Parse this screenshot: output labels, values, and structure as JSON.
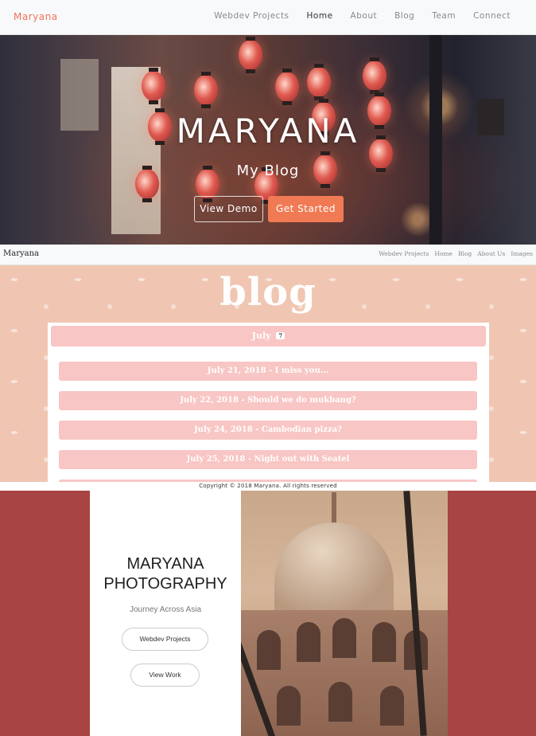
{
  "hero_nav": {
    "brand": "Maryana",
    "links": [
      "Webdev Projects",
      "Home",
      "About",
      "Blog",
      "Team",
      "Connect"
    ],
    "active_link": "Home",
    "accent_color": "#f0735a"
  },
  "hero": {
    "title": "MARYANA",
    "subtitle": "My Blog",
    "demo_label": "View Demo",
    "start_label": "Get Started",
    "start_color": "#f07a54"
  },
  "blog_nav": {
    "brand": "Maryana",
    "links": [
      "Webdev Projects",
      "Home",
      "Blog",
      "About Us",
      "Images"
    ]
  },
  "blog": {
    "title": "blog",
    "month": "July",
    "month_count": "7",
    "posts": [
      "July 21, 2018 - I miss you...",
      "July 22, 2018 - Should we do mukbang?",
      "July 24, 2018 - Cambodian pizza?",
      "July 25, 2018 - Night out with Seatel"
    ],
    "background_color": "#f0c6b2",
    "post_color": "#f8c6c4"
  },
  "blog_footer": "Copyright © 2018 Maryana. All rights reserved",
  "photography": {
    "title_line1": "MARYANA",
    "title_line2": "PHOTOGRAPHY",
    "tagline": "Journey Across Asia",
    "btn_projects": "Webdev Projects",
    "btn_work": "View Work",
    "background_color": "#a84443"
  }
}
